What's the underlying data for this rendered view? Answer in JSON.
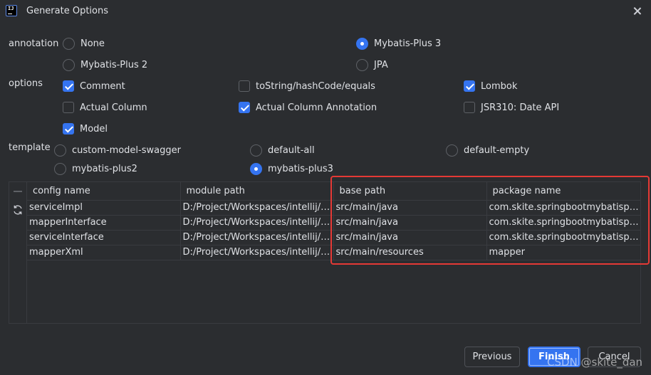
{
  "window": {
    "title": "Generate Options"
  },
  "annotation": {
    "label": "annotation",
    "options": [
      "None",
      "Mybatis-Plus 3",
      "Mybatis-Plus 2",
      "JPA"
    ],
    "selected": "Mybatis-Plus 3"
  },
  "options": {
    "label": "options",
    "items": [
      {
        "label": "Comment",
        "checked": true
      },
      {
        "label": "toString/hashCode/equals",
        "checked": false
      },
      {
        "label": "Lombok",
        "checked": true
      },
      {
        "label": "Actual Column",
        "checked": false
      },
      {
        "label": "Actual Column Annotation",
        "checked": true
      },
      {
        "label": "JSR310: Date API",
        "checked": false
      },
      {
        "label": "Model",
        "checked": true
      }
    ]
  },
  "template": {
    "label": "template",
    "options": [
      "custom-model-swagger",
      "default-all",
      "default-empty",
      "mybatis-plus2",
      "mybatis-plus3"
    ],
    "selected": "mybatis-plus3"
  },
  "table": {
    "headers": [
      "config name",
      "module path",
      "base path",
      "package name"
    ],
    "rows": [
      [
        "serviceImpl",
        "D:/Project/Workspaces/intellij/Spr...",
        "src/main/java",
        "com.skite.springbootmybatisplus...."
      ],
      [
        "mapperInterface",
        "D:/Project/Workspaces/intellij/Spr...",
        "src/main/java",
        "com.skite.springbootmybatisplus...."
      ],
      [
        "serviceInterface",
        "D:/Project/Workspaces/intellij/Spr...",
        "src/main/java",
        "com.skite.springbootmybatisplus...."
      ],
      [
        "mapperXml",
        "D:/Project/Workspaces/intellij/Spr...",
        "src/main/resources",
        "mapper"
      ]
    ]
  },
  "buttons": {
    "previous": "Previous",
    "finish": "Finish",
    "cancel": "Cancel"
  },
  "watermark": "CSDN @skite_dan",
  "colors": {
    "accent": "#3574f0",
    "highlight": "#e53935",
    "background": "#2b2d30"
  }
}
